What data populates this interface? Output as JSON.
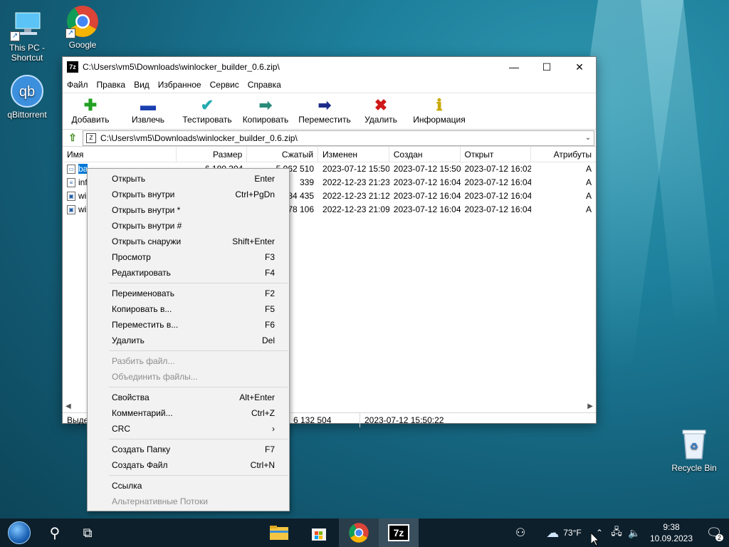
{
  "desktop": {
    "icons": [
      {
        "label": "This PC -\nShortcut",
        "line1": "This PC -",
        "line2": "Shortcut"
      },
      {
        "label": "Google Chrome",
        "line1": "Google",
        "line2": "Ch..."
      },
      {
        "label": "qBittorrent",
        "line1": "qBittorrent",
        "line2": ""
      }
    ],
    "recycle_bin": "Recycle Bin"
  },
  "window": {
    "title": "C:\\Users\\vm5\\Downloads\\winlocker_builder_0.6.zip\\",
    "app_icon_text": "7z",
    "menu": [
      "Файл",
      "Правка",
      "Вид",
      "Избранное",
      "Сервис",
      "Справка"
    ],
    "toolbar": [
      {
        "label": "Добавить",
        "icon": "plus-icon",
        "glyph": "✚",
        "color": "#22a022"
      },
      {
        "label": "Извлечь",
        "icon": "minus-icon",
        "glyph": "▬",
        "color": "#1b3fb0"
      },
      {
        "label": "Тестировать",
        "icon": "check-icon",
        "glyph": "✔",
        "color": "#22aab0"
      },
      {
        "label": "Копировать",
        "icon": "copy-arrows-icon",
        "glyph": "➡",
        "color": "#2a8a7a"
      },
      {
        "label": "Переместить",
        "icon": "move-arrow-icon",
        "glyph": "➡",
        "color": "#1a2a8a"
      },
      {
        "label": "Удалить",
        "icon": "delete-x-icon",
        "glyph": "✖",
        "color": "#d01818"
      },
      {
        "label": "Информация",
        "icon": "info-icon",
        "glyph": "ℹ",
        "color": "#c8a800"
      }
    ],
    "address": "C:\\Users\\vm5\\Downloads\\winlocker_builder_0.6.zip\\",
    "columns": [
      "Имя",
      "Размер",
      "Сжатый",
      "Изменен",
      "Создан",
      "Открыт",
      "Атрибуты"
    ],
    "rows": [
      {
        "name": "ba",
        "size": "6 180 304",
        "packed": "5 962 510",
        "modified": "2023-07-12 15:50",
        "created": "2023-07-12 15:50",
        "accessed": "2023-07-12 16:02",
        "attr": "A"
      },
      {
        "name": "inf",
        "size": "",
        "packed": "339",
        "modified": "2022-12-23 21:23",
        "created": "2023-07-12 16:04",
        "accessed": "2023-07-12 16:04",
        "attr": "A"
      },
      {
        "name": "wi",
        "size": "",
        "packed": "84 435",
        "modified": "2022-12-23 21:12",
        "created": "2023-07-12 16:04",
        "accessed": "2023-07-12 16:04",
        "attr": "A"
      },
      {
        "name": "wi",
        "size": "",
        "packed": "78 106",
        "modified": "2022-12-23 21:09",
        "created": "2023-07-12 16:04",
        "accessed": "2023-07-12 16:04",
        "attr": "A"
      }
    ],
    "status": {
      "left": "Выдел",
      "size": "6 132 504",
      "date": "2023-07-12 15:50:22"
    }
  },
  "context_menu": {
    "groups": [
      [
        {
          "label": "Открыть",
          "shortcut": "Enter"
        },
        {
          "label": "Открыть внутри",
          "shortcut": "Ctrl+PgDn"
        },
        {
          "label": "Открыть внутри *",
          "shortcut": ""
        },
        {
          "label": "Открыть внутри #",
          "shortcut": ""
        },
        {
          "label": "Открыть снаружи",
          "shortcut": "Shift+Enter"
        },
        {
          "label": "Просмотр",
          "shortcut": "F3"
        },
        {
          "label": "Редактировать",
          "shortcut": "F4"
        }
      ],
      [
        {
          "label": "Переименовать",
          "shortcut": "F2"
        },
        {
          "label": "Копировать в...",
          "shortcut": "F5"
        },
        {
          "label": "Переместить в...",
          "shortcut": "F6"
        },
        {
          "label": "Удалить",
          "shortcut": "Del"
        }
      ],
      [
        {
          "label": "Разбить файл...",
          "shortcut": "",
          "disabled": true
        },
        {
          "label": "Объединить файлы...",
          "shortcut": "",
          "disabled": true
        }
      ],
      [
        {
          "label": "Свойства",
          "shortcut": "Alt+Enter"
        },
        {
          "label": "Комментарий...",
          "shortcut": "Ctrl+Z"
        },
        {
          "label": "CRC",
          "shortcut": "›"
        }
      ],
      [
        {
          "label": "Создать Папку",
          "shortcut": "F7"
        },
        {
          "label": "Создать Файл",
          "shortcut": "Ctrl+N"
        }
      ],
      [
        {
          "label": "Ссылка",
          "shortcut": ""
        },
        {
          "label": "Альтернативные Потоки",
          "shortcut": "",
          "disabled": true
        }
      ]
    ]
  },
  "taskbar": {
    "weather": "73°F",
    "time": "9:38",
    "date": "10.09.2023",
    "notifications": "2",
    "seven_zip_label": "7z"
  }
}
